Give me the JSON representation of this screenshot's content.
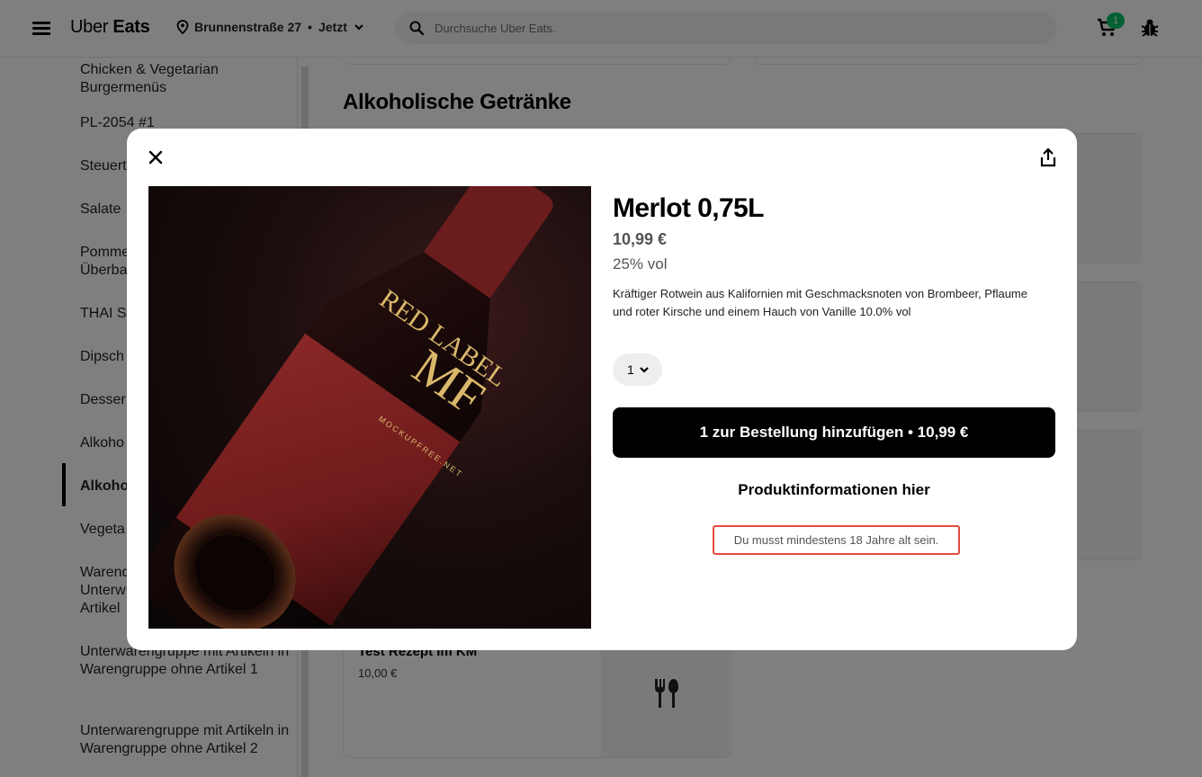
{
  "header": {
    "logo_light": "Uber",
    "logo_bold": "Eats",
    "address": "Brunnenstraße 27",
    "separator": "•",
    "time": "Jetzt",
    "search_placeholder": "Durchsuche Uber Eats.",
    "cart_count": "1",
    "icons": [
      "menu-icon",
      "pin-icon",
      "chevron-down-icon",
      "search-icon",
      "cart-icon",
      "bug-icon"
    ]
  },
  "sidebar": {
    "items": [
      {
        "label": "Chicken & Vegetarian Burgermenüs"
      },
      {
        "label": "PL-2054 #1"
      },
      {
        "label": "Steuert"
      },
      {
        "label": "Salate"
      },
      {
        "label": "Pomme Überba"
      },
      {
        "label": "THAI Sc"
      },
      {
        "label": "Dipsch"
      },
      {
        "label": "Desser"
      },
      {
        "label": "Alkoho"
      },
      {
        "label": "Alkoho"
      },
      {
        "label": "Vegeta"
      },
      {
        "label": "Warenq Unterw Artikel"
      },
      {
        "label": "Unterwarengruppe mit Artikeln in Warengruppe ohne Artikel 1"
      },
      {
        "label": "Unterwarengruppe mit Artikeln in Warengruppe ohne Artikel 2"
      }
    ]
  },
  "main": {
    "section_title": "Alkoholische Getränke",
    "card": {
      "name": "Test Rezept im KM",
      "price": "10,00 €"
    }
  },
  "modal": {
    "title": "Merlot 0,75L",
    "price": "10,99 €",
    "abv": "25% vol",
    "description": "Kräftiger Rotwein aus Kalifornien mit Geschmacksnoten von Brombeer, Pflaume und roter Kirsche und einem Hauch von Vanille 10.0% vol",
    "quantity": "1",
    "add_button": "1 zur Bestellung hinzufügen • 10,99 €",
    "info_link": "Produktinformationen hier",
    "age_notice": "Du musst mindestens 18 Jahre alt sein.",
    "label_big": "MF",
    "label_arc": "RED LABEL",
    "label_small": "MOCKUPFREE.NET",
    "icons": [
      "close-icon",
      "share-icon"
    ]
  },
  "colors": {
    "accent": "#000000",
    "badge": "#06c167",
    "age_notice_border": "#e54b3c",
    "wine_label": "#7a1f1f"
  }
}
